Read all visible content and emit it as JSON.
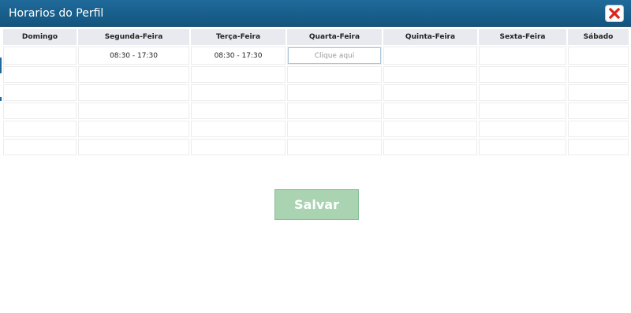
{
  "dialog": {
    "title": "Horarios do Perfil",
    "close_icon": "close-x-icon",
    "close_color": "#d9261c",
    "header_color": "#1b5f8c"
  },
  "table": {
    "headers": [
      "Domingo",
      "Segunda-Feira",
      "Terça-Feira",
      "Quarta-Feira",
      "Quinta-Feira",
      "Sexta-Feira",
      "Sábado"
    ],
    "rows": [
      [
        "",
        "08:30 - 17:30",
        "08:30 - 17:30",
        "",
        "",
        "",
        ""
      ],
      [
        "",
        "",
        "",
        "",
        "",
        "",
        ""
      ],
      [
        "",
        "",
        "",
        "",
        "",
        "",
        ""
      ],
      [
        "",
        "",
        "",
        "",
        "",
        "",
        ""
      ],
      [
        "",
        "",
        "",
        "",
        "",
        "",
        ""
      ],
      [
        "",
        "",
        "",
        "",
        "",
        "",
        ""
      ]
    ],
    "active_cell_placeholder": "Clique aqui"
  },
  "save_button": {
    "label": "Salvar",
    "color": "#a9d3b1"
  }
}
